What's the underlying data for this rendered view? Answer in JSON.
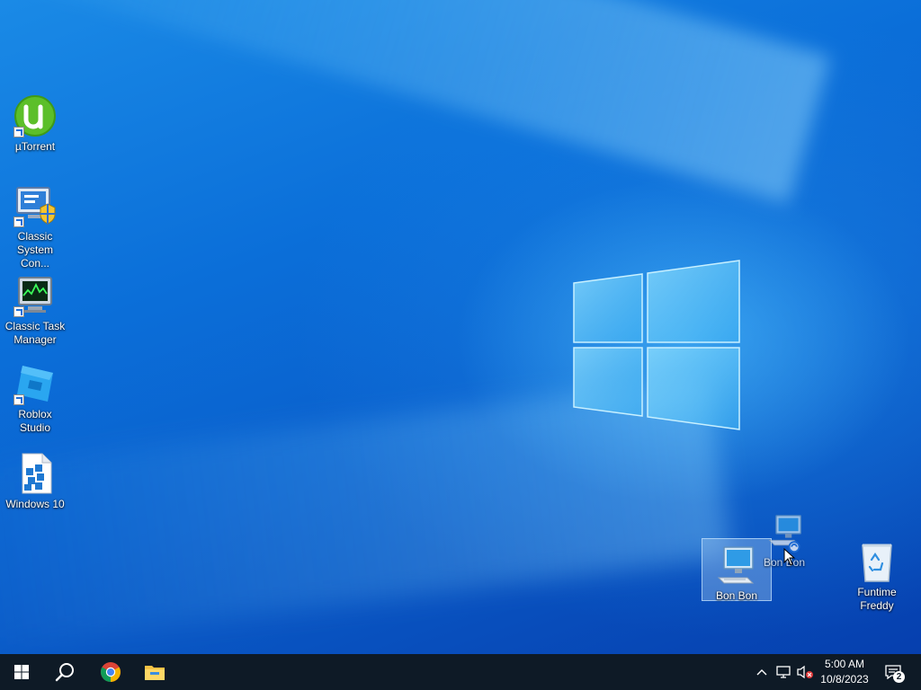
{
  "desktop": {
    "icons": [
      {
        "label": "µTorrent",
        "icon": "utorrent-icon"
      },
      {
        "label": "Classic System Con...",
        "icon": "control-panel-icon"
      },
      {
        "label": "Classic Task Manager",
        "icon": "task-manager-icon"
      },
      {
        "label": "Roblox Studio",
        "icon": "roblox-studio-icon"
      },
      {
        "label": "Windows 10",
        "icon": "windows-10-file-icon"
      },
      {
        "label": "Bon Bon",
        "icon": "network-computer-icon",
        "state": "selected"
      },
      {
        "label": "Bon Bon",
        "icon": "network-computer-icon",
        "state": "dragging"
      },
      {
        "label": "Funtime Freddy",
        "icon": "recycle-bin-icon"
      }
    ]
  },
  "taskbar": {
    "buttons": [
      "start-icon",
      "search-icon",
      "chrome-icon",
      "file-explorer-icon"
    ],
    "tray": [
      "show-hidden-icons",
      "network-icon",
      "volume-muted-icon"
    ],
    "clock": {
      "time": "5:00 AM",
      "date": "10/8/2023"
    },
    "notifications": {
      "count": "2"
    }
  },
  "colors": {
    "taskbar": "#0e1a26",
    "accent": "#0a6fd6"
  }
}
